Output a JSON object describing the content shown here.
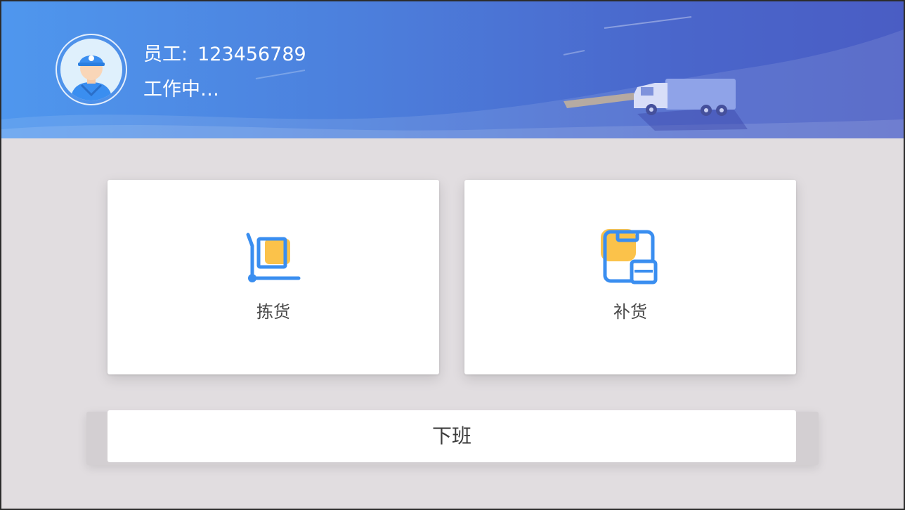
{
  "header": {
    "employee_label": "员工:",
    "employee_id": "123456789",
    "status": "工作中…",
    "avatar_icon": "worker-avatar-icon",
    "gradient": [
      "#4f97ee",
      "#4a5dc4"
    ]
  },
  "menu": {
    "pick": {
      "label": "拣货",
      "icon": "cart-box-icon"
    },
    "restock": {
      "label": "补货",
      "icon": "clipboard-restock-icon"
    }
  },
  "footer": {
    "offwork_label": "下班"
  },
  "colors": {
    "primary_blue": "#3a8ef0",
    "accent_yellow": "#fbc24a",
    "background": "#e1dde0"
  }
}
